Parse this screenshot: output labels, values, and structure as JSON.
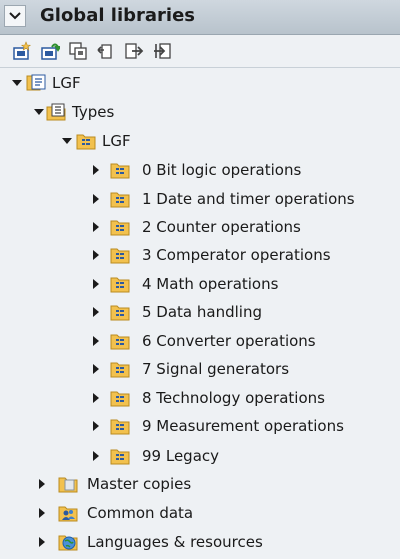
{
  "panel": {
    "title": "Global libraries"
  },
  "toolbar": {
    "buttons": [
      {
        "icon": "new-library-icon"
      },
      {
        "icon": "open-library-icon"
      },
      {
        "icon": "save-library-icon"
      },
      {
        "icon": "close-library-icon"
      },
      {
        "icon": "export-icon"
      },
      {
        "icon": "import-icon"
      }
    ]
  },
  "tree": {
    "root": {
      "label": "LGF",
      "icon": "library-icon",
      "expanded": true
    },
    "types": {
      "label": "Types",
      "icon": "types-folder-icon",
      "expanded": true
    },
    "lgf_folder": {
      "label": "LGF",
      "icon": "type-folder-icon",
      "expanded": true
    },
    "categories": [
      {
        "label": "0 Bit logic operations"
      },
      {
        "label": "1 Date and timer operations"
      },
      {
        "label": "2 Counter operations"
      },
      {
        "label": "3 Comperator operations"
      },
      {
        "label": "4 Math operations"
      },
      {
        "label": "5 Data handling"
      },
      {
        "label": "6 Converter operations"
      },
      {
        "label": "7 Signal generators"
      },
      {
        "label": "8 Technology operations"
      },
      {
        "label": "9 Measurement operations"
      },
      {
        "label": "99 Legacy"
      }
    ],
    "master_copies": {
      "label": "Master copies",
      "icon": "master-copies-folder-icon"
    },
    "common_data": {
      "label": "Common data",
      "icon": "common-data-icon"
    },
    "languages": {
      "label": "Languages & resources",
      "icon": "globe-icon"
    }
  },
  "colors": {
    "folder": "#f2c14e",
    "folder_border": "#b98a1f",
    "type_glyph": "#2c5aa0"
  }
}
